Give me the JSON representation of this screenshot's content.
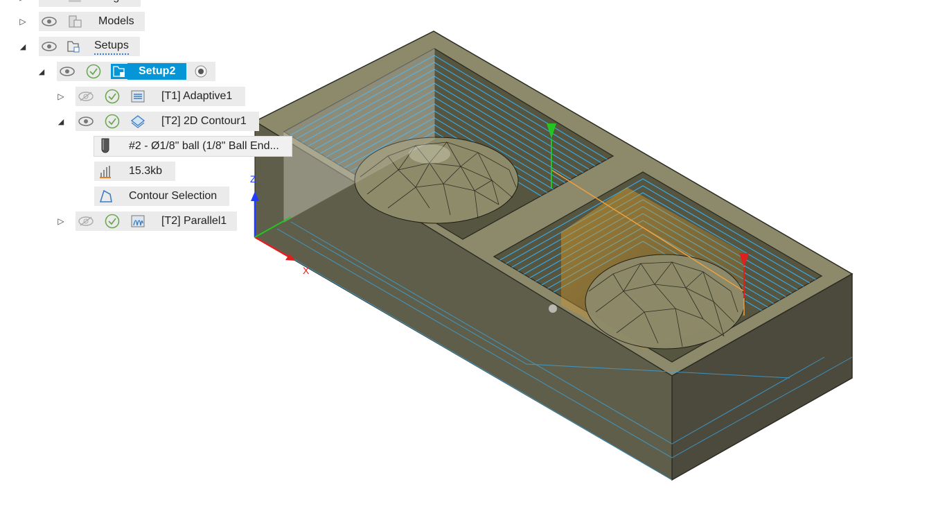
{
  "browser": {
    "items": [
      {
        "label": "Origin",
        "expanded": false
      },
      {
        "label": "Models",
        "expanded": false
      },
      {
        "label": "Setups",
        "expanded": true
      },
      {
        "label": "Setup2",
        "expanded": true,
        "selected": true
      },
      {
        "label": "[T1] Adaptive1",
        "expanded": false,
        "visible": false
      },
      {
        "label": "[T2] 2D Contour1",
        "expanded": true,
        "visible": true
      },
      {
        "label": "#2 - Ø1/8\" ball (1/8\" Ball End..."
      },
      {
        "label": "15.3kb"
      },
      {
        "label": "Contour Selection"
      },
      {
        "label": "[T2] Parallel1",
        "expanded": false,
        "visible": false
      }
    ]
  },
  "axes": {
    "z": "Z",
    "x": "X"
  },
  "colors": {
    "selection": "#0696d7",
    "stock_top": "#8d8a6c",
    "stock_front": "#5b5a47",
    "stock_side": "#4a493b",
    "toolpath": "#3aa6e0",
    "check": "#6aa84f"
  },
  "icons": [
    "eye-icon",
    "eye-hidden-icon",
    "check-icon",
    "tool-icon",
    "file-size-icon",
    "contour-icon",
    "origin-icon"
  ]
}
